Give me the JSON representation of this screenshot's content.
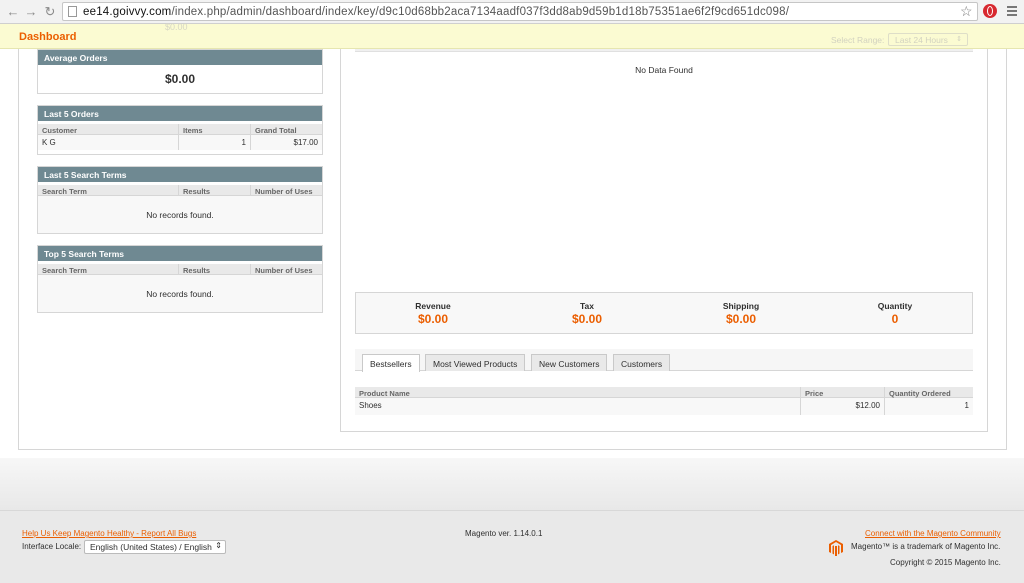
{
  "browser": {
    "url_host": "ee14.goivvy.com",
    "url_path": "/index.php/admin/dashboard/index/key/d9c10d68bb2aca7134aadf037f3dd8ab9d59b1d18b75351ae6f2f9cd651dc098/"
  },
  "header": {
    "title": "Dashboard",
    "faded_amount": "$0.00",
    "range_label": "Select Range:",
    "range_value": "Last 24 Hours"
  },
  "average_orders": {
    "title": "Average Orders",
    "amount": "$0.00"
  },
  "last_orders": {
    "title": "Last 5 Orders",
    "columns": [
      "Customer",
      "Items",
      "Grand Total"
    ],
    "rows": [
      {
        "customer": "K G",
        "items": "1",
        "grand_total": "$17.00"
      }
    ]
  },
  "last_search_terms": {
    "title": "Last 5 Search Terms",
    "columns": [
      "Search Term",
      "Results",
      "Number of Uses"
    ],
    "empty": "No records found."
  },
  "top_search_terms": {
    "title": "Top 5 Search Terms",
    "columns": [
      "Search Term",
      "Results",
      "Number of Uses"
    ],
    "empty": "No records found."
  },
  "chart": {
    "no_data": "No Data Found"
  },
  "totals": [
    {
      "label": "Revenue",
      "value": "$0.00"
    },
    {
      "label": "Tax",
      "value": "$0.00"
    },
    {
      "label": "Shipping",
      "value": "$0.00"
    },
    {
      "label": "Quantity",
      "value": "0"
    }
  ],
  "tabs": [
    {
      "label": "Bestsellers",
      "active": true
    },
    {
      "label": "Most Viewed Products",
      "active": false
    },
    {
      "label": "New Customers",
      "active": false
    },
    {
      "label": "Customers",
      "active": false
    }
  ],
  "products": {
    "columns": [
      "Product Name",
      "Price",
      "Quantity Ordered"
    ],
    "rows": [
      {
        "name": "Shoes",
        "price": "$12.00",
        "qty": "1"
      }
    ]
  },
  "footer": {
    "help_link": "Help Us Keep Magento Healthy - Report All Bugs",
    "locale_label": "Interface Locale:",
    "locale_value": "English (United States) / English",
    "version": "Magento ver. 1.14.0.1",
    "community_link": "Connect with the Magento Community",
    "trademark": "Magento™ is a trademark of Magento Inc.",
    "copyright": "Copyright © 2015 Magento Inc."
  },
  "colors": {
    "accent": "#eb5e00",
    "box_header": "#6f8992",
    "header_bar": "#fbfbd2"
  }
}
